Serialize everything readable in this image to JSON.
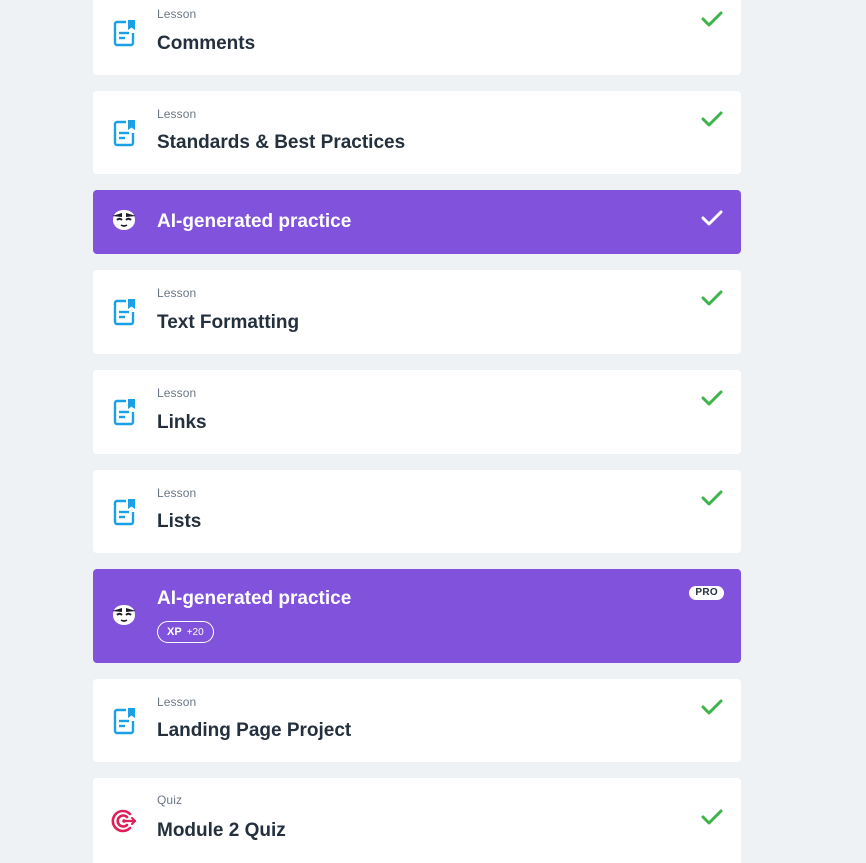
{
  "items": [
    {
      "kind": "lesson",
      "type_label": "Lesson",
      "title": "Comments",
      "completed": true
    },
    {
      "kind": "lesson",
      "type_label": "Lesson",
      "title": "Standards & Best Practices",
      "completed": true
    },
    {
      "kind": "ai",
      "title": "AI-generated practice",
      "completed": true
    },
    {
      "kind": "lesson",
      "type_label": "Lesson",
      "title": "Text Formatting",
      "completed": true
    },
    {
      "kind": "lesson",
      "type_label": "Lesson",
      "title": "Links",
      "completed": true
    },
    {
      "kind": "lesson",
      "type_label": "Lesson",
      "title": "Lists",
      "completed": true
    },
    {
      "kind": "ai",
      "title": "AI-generated practice",
      "badge": "PRO",
      "xp_label": "XP",
      "xp_value": "+20",
      "completed": false
    },
    {
      "kind": "lesson",
      "type_label": "Lesson",
      "title": "Landing Page Project",
      "completed": true
    },
    {
      "kind": "quiz",
      "type_label": "Quiz",
      "title": "Module 2 Quiz",
      "completed": true
    }
  ],
  "icons": {
    "lesson": "lesson-document-icon",
    "ai": "ai-mascot-icon",
    "quiz": "quiz-target-icon",
    "done": "checkmark-icon"
  },
  "colors": {
    "background": "#eef2f5",
    "card": "#ffffff",
    "ai_card": "#8153dc",
    "check": "#3bb44a",
    "lesson_icon": "#1aa0e6",
    "quiz_icon": "#e01e5a",
    "text": "#24303d",
    "muted": "#6b7785"
  }
}
